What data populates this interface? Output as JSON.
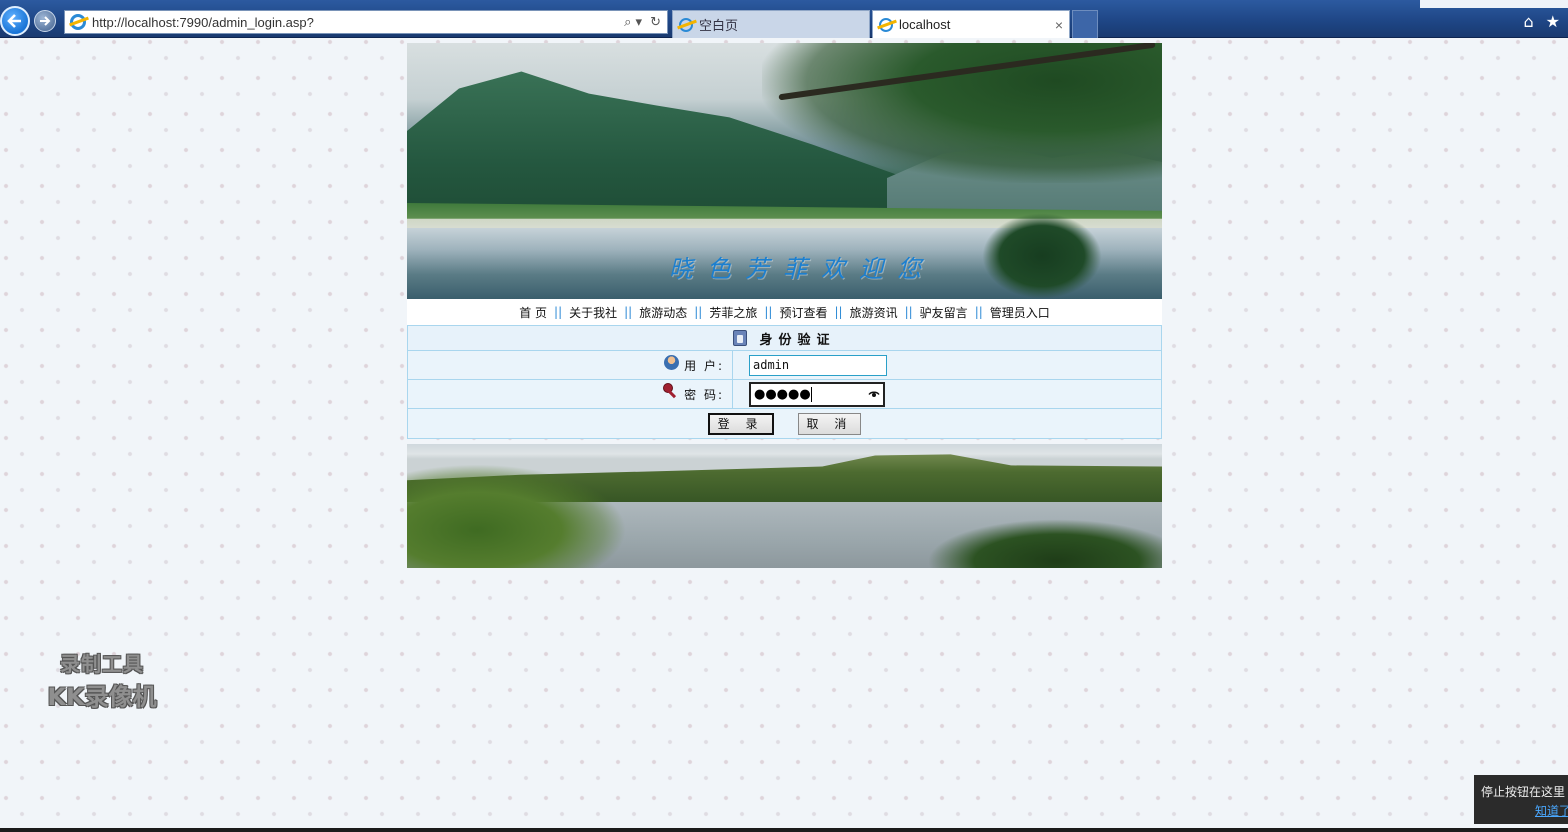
{
  "browser": {
    "address_url": "http://localhost:7990/admin_login.asp?",
    "tabs": [
      {
        "label": "空白页",
        "active": false
      },
      {
        "label": "localhost",
        "active": true
      }
    ],
    "tab_close_glyph": "×",
    "search_glyph": "⌕ ▾",
    "refresh_glyph": "↻",
    "home_glyph": "⌂",
    "favorites_glyph": "★"
  },
  "banner": {
    "welcome_text": "晓色芳菲欢迎您"
  },
  "nav": {
    "items": [
      "首 页",
      "关于我社",
      "旅游动态",
      "芳菲之旅",
      "预订查看",
      "旅游资讯",
      "驴友留言",
      "管理员入口"
    ],
    "separator": "||"
  },
  "login": {
    "title": "身份验证",
    "username_label": "用 户:",
    "username_value": "admin",
    "password_label": "密 码:",
    "password_masked": "●●●●●",
    "login_button": "登 录",
    "cancel_button": "取 消"
  },
  "watermark": {
    "line1": "录制工具",
    "line2": "KK录像机"
  },
  "tooltip": {
    "text": "停止按钮在这里",
    "link": "知道了"
  },
  "colors": {
    "nav_separator": "#2f8bd6",
    "welcome_text": "#1b7fd0",
    "login_border": "#a9d6ee",
    "login_bg": "#eaf4fb"
  }
}
